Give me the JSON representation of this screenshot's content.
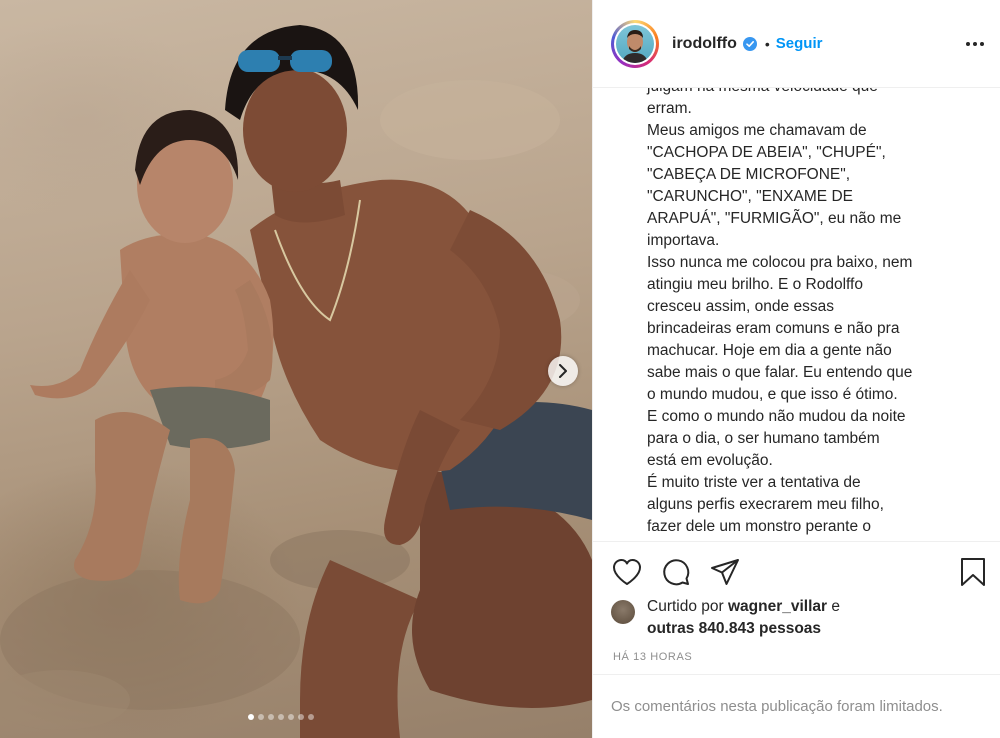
{
  "post": {
    "photo": {
      "carousel_slides": 7,
      "current_slide": 1,
      "next_icon": "chevron-right-icon"
    },
    "author": {
      "username": "irodolffo",
      "verified": true,
      "separator": "•",
      "follow_label": "Seguir",
      "more_icon": "more-horizontal-icon"
    },
    "caption": {
      "lines": [
        "julgam na mesma velocidade que",
        "erram.",
        "Meus amigos me chamavam de",
        "\"CACHOPA DE ABEIA\", \"CHUPÉ\",",
        "\"CABEÇA DE MICROFONE\",",
        "\"CARUNCHO\", \"ENXAME DE",
        "ARAPUÁ\", \"FURMIGÃO\", eu não me",
        "importava.",
        "Isso nunca me colocou pra baixo, nem",
        "atingiu meu brilho. E o Rodolffo",
        "cresceu assim, onde essas",
        "brincadeiras eram comuns e não pra",
        "machucar. Hoje em dia a gente não",
        "sabe mais o que falar. Eu entendo que",
        "o mundo mudou, e que isso é ótimo.",
        "E como o mundo não mudou da noite",
        "para o dia, o ser humano também",
        "está em evolução.",
        "É muito triste ver a tentativa de",
        "alguns perfis execrarem meu filho,",
        "fazer dele um monstro perante o"
      ]
    },
    "actions": {
      "like_icon": "heart-icon",
      "comment_icon": "comment-icon",
      "share_icon": "share-icon",
      "save_icon": "bookmark-icon"
    },
    "likes": {
      "prefix": "Curtido por",
      "liked_by": "wagner_villar",
      "conjunction": "e",
      "others_label": "outras 840.843 pessoas"
    },
    "timestamp": "HÁ 13 HORAS",
    "comments_notice": "Os comentários nesta publicação foram limitados."
  },
  "colors": {
    "link_blue": "#0095f6",
    "text": "#262626",
    "muted": "#8e8e8e",
    "divider": "#efefef"
  }
}
